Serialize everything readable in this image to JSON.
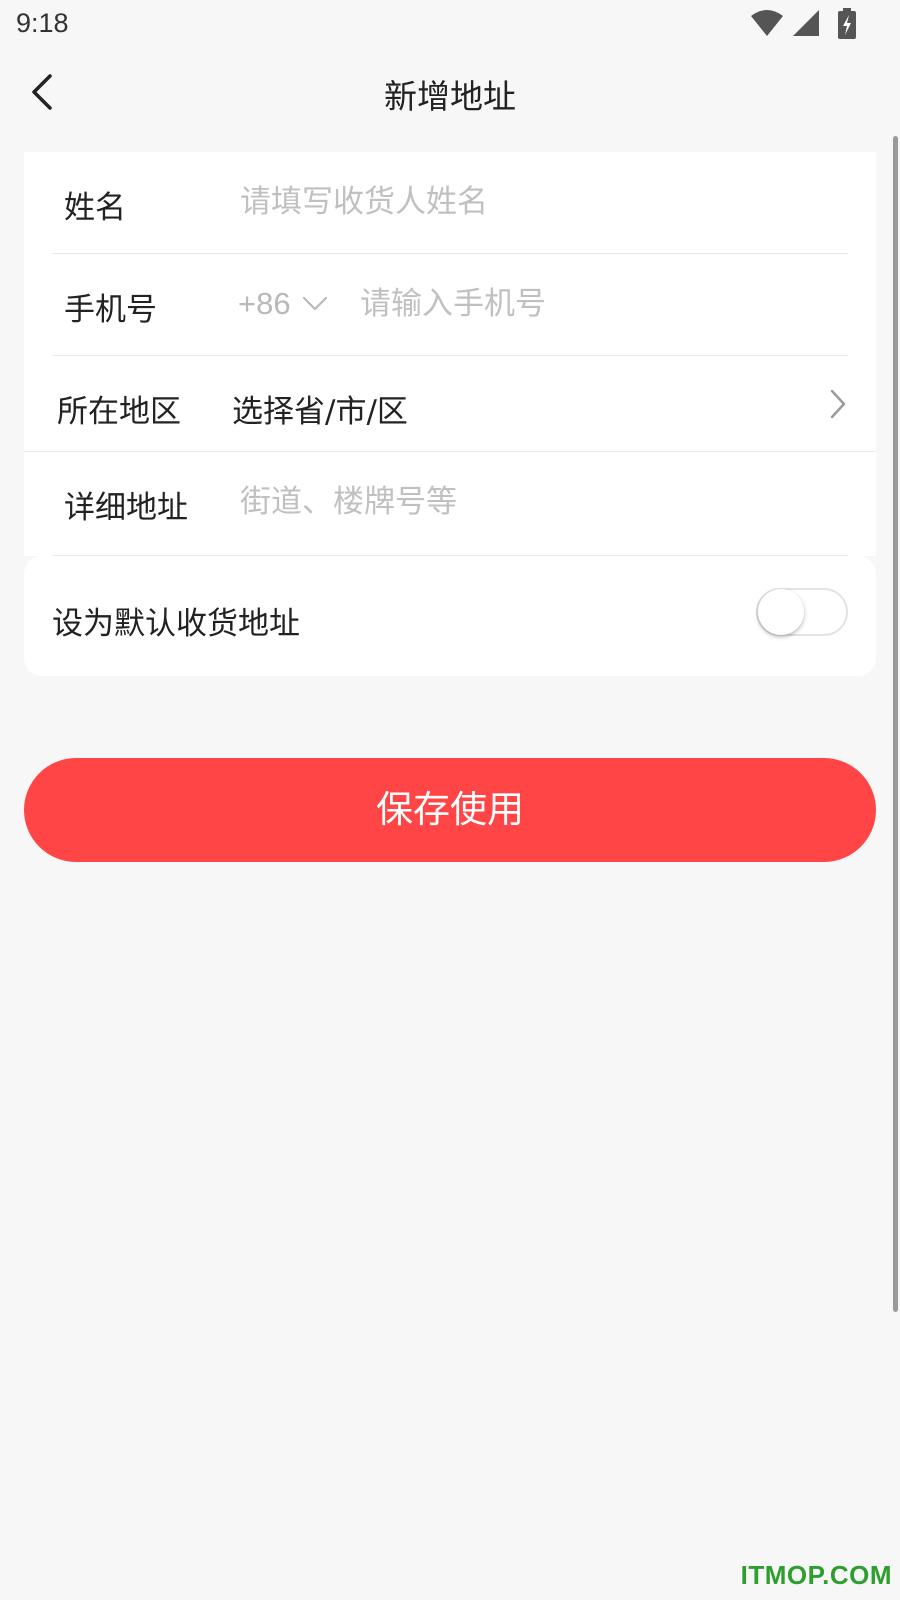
{
  "status_bar": {
    "time": "9:18",
    "icons": [
      "wifi-icon",
      "cellular-signal-icon",
      "battery-charging-icon"
    ]
  },
  "header": {
    "title": "新增地址",
    "back_icon": "chevron-left-icon"
  },
  "form": {
    "name": {
      "label": "姓名",
      "value": "",
      "placeholder": "请填写收货人姓名"
    },
    "phone": {
      "label": "手机号",
      "country_code": "+86",
      "value": "",
      "placeholder": "请输入手机号"
    },
    "region": {
      "label": "所在地区",
      "value": "选择省/市/区"
    },
    "address": {
      "label": "详细地址",
      "value": "",
      "placeholder": "街道、楼牌号等"
    }
  },
  "default_address": {
    "label": "设为默认收货地址",
    "enabled": false
  },
  "save_button": {
    "label": "保存使用",
    "color": "#ff4546"
  },
  "watermark": "ITMOP.COM",
  "colors": {
    "background": "#f7f7f7",
    "placeholder": "#c0c0c0",
    "accent": "#ff4546"
  }
}
